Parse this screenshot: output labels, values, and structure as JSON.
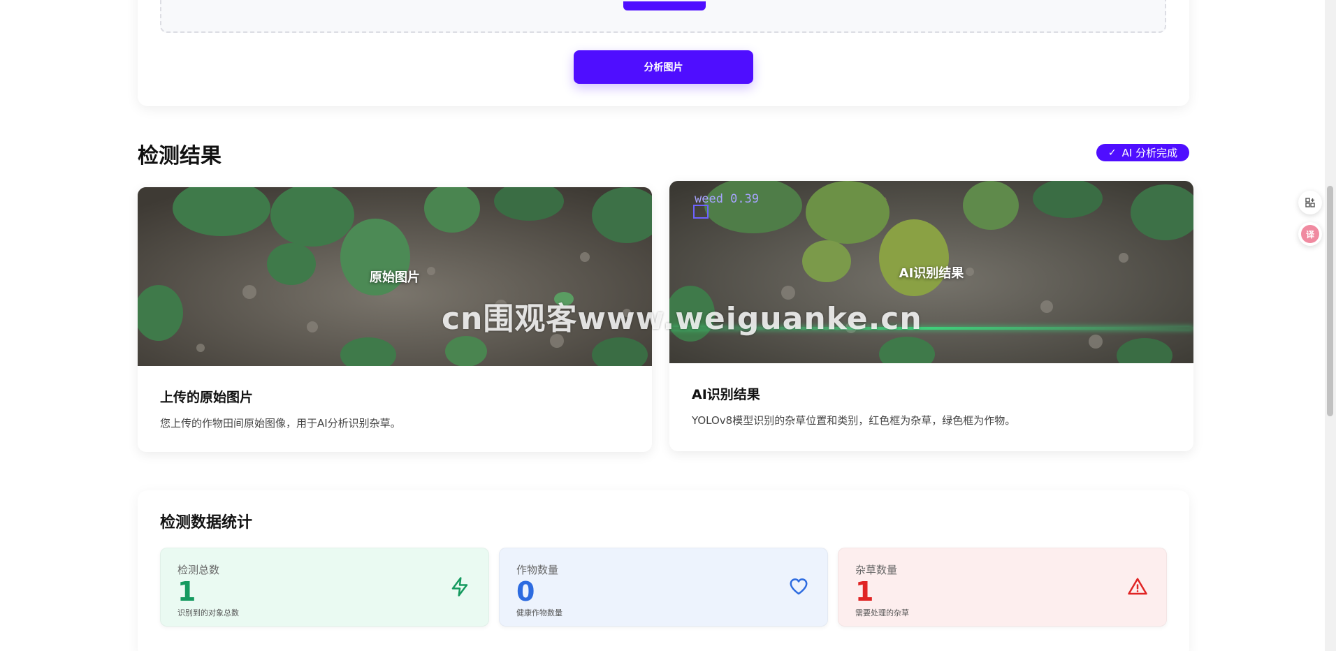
{
  "upload": {
    "analyze_button": "分析图片"
  },
  "results": {
    "title": "检测结果",
    "status_badge": "AI 分析完成",
    "original": {
      "overlay_label": "原始图片",
      "title": "上传的原始图片",
      "description": "您上传的作物田间原始图像，用于AI分析识别杂草。"
    },
    "ai": {
      "overlay_label": "AI识别结果",
      "detection_label": "weed 0.39",
      "title": "AI识别结果",
      "description": "YOLOv8模型识别的杂草位置和类别，红色框为杂草，绿色框为作物。"
    }
  },
  "watermark": "cn围观客www.weiguanke.cn",
  "stats": {
    "title": "检测数据统计",
    "total": {
      "label": "检测总数",
      "value": "1",
      "sub": "识别到的对象总数",
      "icon": "zap-icon",
      "color": "#159a5f"
    },
    "crop": {
      "label": "作物数量",
      "value": "0",
      "sub": "健康作物数量",
      "icon": "heart-icon",
      "color": "#2d6be0"
    },
    "weed": {
      "label": "杂草数量",
      "value": "1",
      "sub": "需要处理的杂草",
      "icon": "warning-icon",
      "color": "#e02424"
    }
  },
  "floating": {
    "translate_label": "译"
  },
  "colors": {
    "accent": "#4f0eff"
  }
}
